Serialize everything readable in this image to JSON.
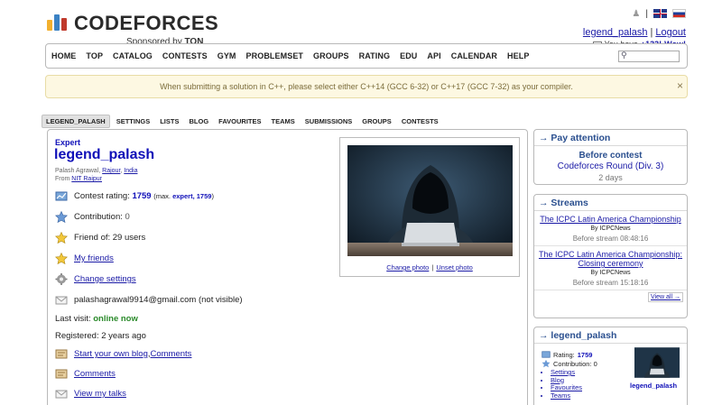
{
  "logo": {
    "text_main": "CODEFORCES",
    "sponsored_prefix": "Sponsored by",
    "sponsor": "TON",
    "bar_colors": [
      "#f2b02e",
      "#3b82c4",
      "#c0392b"
    ]
  },
  "header": {
    "lang_sep": "|",
    "user": "legend_palash",
    "logout": "Logout",
    "user_sep": "|",
    "you_have": "You have",
    "notifications": "+133!",
    "wow": "Wow!"
  },
  "menu": {
    "items": [
      "HOME",
      "TOP",
      "CATALOG",
      "CONTESTS",
      "GYM",
      "PROBLEMSET",
      "GROUPS",
      "RATING",
      "EDU",
      "API",
      "CALENDAR",
      "HELP"
    ]
  },
  "notice": {
    "text": "When submitting a solution in C++, please select either C++14 (GCC 6-32) or C++17 (GCC 7-32) as your compiler.",
    "close": "×"
  },
  "second_menu": {
    "items": [
      "LEGEND_PALASH",
      "SETTINGS",
      "LISTS",
      "BLOG",
      "FAVOURITES",
      "TEAMS",
      "SUBMISSIONS",
      "GROUPS",
      "CONTESTS"
    ]
  },
  "profile": {
    "rank": "Expert",
    "handle": "legend_palash",
    "name_prefix": "Palash Agrawal, ",
    "city": "Rajour",
    "country": "India",
    "from_prefix": "From ",
    "org": "NIT Raipur",
    "contest_rating_label": "Contest rating:",
    "contest_rating": "1759",
    "max_prefix": "(max.",
    "max_rank": "expert, 1759",
    "max_suffix": ")",
    "contribution_label": "Contribution:",
    "contribution": "0",
    "friend_of": "Friend of: 29 users",
    "my_friends": "My friends",
    "change_settings": "Change settings",
    "email": "palashagrawal9914@gmail.com (not visible)",
    "last_visit_label": "Last visit:",
    "last_visit": "online now",
    "registered": "Registered: 2 years ago",
    "start_blog": "Start your own blog",
    "comma": ", ",
    "comments_inline": "Comments",
    "comments": "Comments",
    "view_talks": "View my talks",
    "change_photo": "Change photo",
    "photo_sep": "|",
    "unset_photo": "Unset photo"
  },
  "pay_attention": {
    "title": "→ Pay attention",
    "line1": "Before contest",
    "line2": "Codeforces Round (Div. 3)",
    "line3": "2 days"
  },
  "streams": {
    "title": "→ Streams",
    "items": [
      {
        "title": "The ICPC Latin America Championship",
        "by": "By ICPCNews",
        "before": "Before stream 08:48:16"
      },
      {
        "title": "The ICPC Latin America Championship: Closing ceremony",
        "by": "By ICPCNews",
        "before": "Before stream 15:18:16"
      }
    ],
    "view_all": "View all →"
  },
  "legend_box": {
    "title": "→ legend_palash",
    "rating_label": "Rating:",
    "rating": "1759",
    "contribution_label": "Contribution:",
    "contribution": "0",
    "links": [
      "Settings",
      "Blog",
      "Favourites",
      "Teams"
    ],
    "name": "legend_palash"
  }
}
